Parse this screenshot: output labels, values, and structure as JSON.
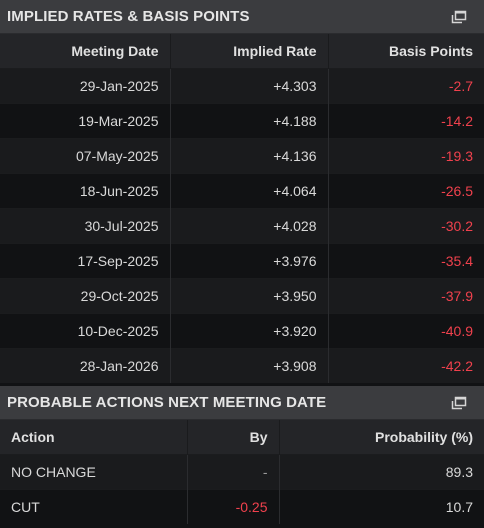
{
  "implied": {
    "title": "IMPLIED RATES & BASIS POINTS",
    "columns": [
      "Meeting Date",
      "Implied Rate",
      "Basis Points"
    ],
    "rows": [
      {
        "date": "29-Jan-2025",
        "rate": "+4.303",
        "bp": "-2.7"
      },
      {
        "date": "19-Mar-2025",
        "rate": "+4.188",
        "bp": "-14.2"
      },
      {
        "date": "07-May-2025",
        "rate": "+4.136",
        "bp": "-19.3"
      },
      {
        "date": "18-Jun-2025",
        "rate": "+4.064",
        "bp": "-26.5"
      },
      {
        "date": "30-Jul-2025",
        "rate": "+4.028",
        "bp": "-30.2"
      },
      {
        "date": "17-Sep-2025",
        "rate": "+3.976",
        "bp": "-35.4"
      },
      {
        "date": "29-Oct-2025",
        "rate": "+3.950",
        "bp": "-37.9"
      },
      {
        "date": "10-Dec-2025",
        "rate": "+3.920",
        "bp": "-40.9"
      },
      {
        "date": "28-Jan-2026",
        "rate": "+3.908",
        "bp": "-42.2"
      }
    ]
  },
  "probable": {
    "title": "PROBABLE ACTIONS NEXT MEETING DATE",
    "columns": [
      "Action",
      "By",
      "Probability (%)"
    ],
    "rows": [
      {
        "action": "NO CHANGE",
        "by": "-",
        "prob": "89.3"
      },
      {
        "action": "CUT",
        "by": "-0.25",
        "prob": "10.7"
      }
    ]
  },
  "colors": {
    "header_bg": "#3b3c3f",
    "negative": "#f0414d",
    "text": "#d9d9d9"
  },
  "icons": {
    "popout": "popout-window-icon"
  }
}
